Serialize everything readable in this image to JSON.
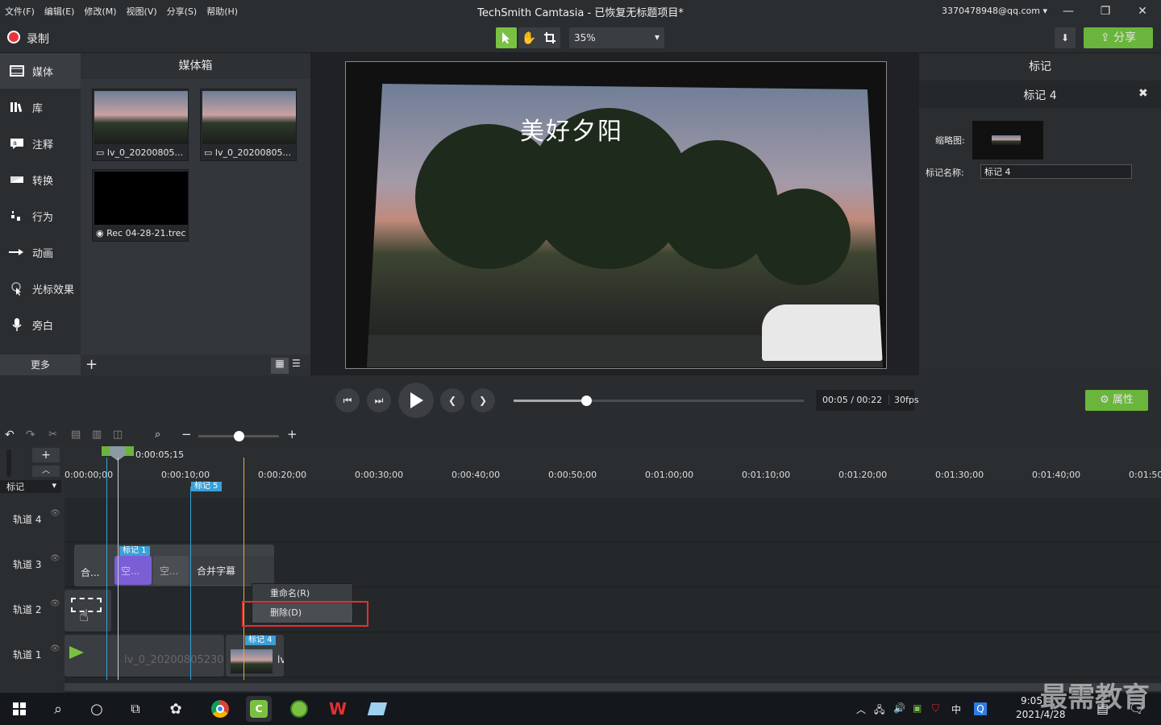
{
  "window": {
    "title": "TechSmith Camtasia - 已恢复无标题项目*",
    "account": "3370478948@qq.com",
    "menu": [
      "文件(F)",
      "编辑(E)",
      "修改(M)",
      "视图(V)",
      "分享(S)",
      "帮助(H)"
    ]
  },
  "toolbar": {
    "record_label": "录制",
    "zoom_value": "35%",
    "share_label": "分享"
  },
  "sidebar": {
    "items": [
      {
        "label": "媒体",
        "icon": "film-icon"
      },
      {
        "label": "库",
        "icon": "library-icon"
      },
      {
        "label": "注释",
        "icon": "annotation-icon"
      },
      {
        "label": "转换",
        "icon": "transition-icon"
      },
      {
        "label": "行为",
        "icon": "behavior-icon"
      },
      {
        "label": "动画",
        "icon": "animation-icon"
      },
      {
        "label": "光标效果",
        "icon": "cursor-icon"
      },
      {
        "label": "旁白",
        "icon": "microphone-icon"
      }
    ],
    "more_label": "更多"
  },
  "media_bin": {
    "title": "媒体箱",
    "items": [
      {
        "name": "lv_0_20200805..."
      },
      {
        "name": "lv_0_20200805..."
      },
      {
        "name": "Rec 04-28-21.trec"
      }
    ]
  },
  "preview": {
    "video_title": "美好夕阳"
  },
  "properties": {
    "header": "标记",
    "subheader": "标记 4",
    "thumb_label": "缩略图:",
    "name_label": "标记名称:",
    "name_value": "标记 4"
  },
  "playback": {
    "progress": 0.25,
    "time": "00:05 / 00:22",
    "fps": "30fps",
    "attr_label": "属性"
  },
  "timeline": {
    "playhead_time": "0:00:05;15",
    "ticks": [
      "0:00:00;00",
      "0:00:10;00",
      "0:00:20;00",
      "0:00:30;00",
      "0:00:40;00",
      "0:00:50;00",
      "0:01:00;00",
      "0:01:10;00",
      "0:01:20;00",
      "0:01:30;00",
      "0:01:40;00",
      "0:01:50;"
    ],
    "marker_label": "标记",
    "tracks": [
      "轨道 4",
      "轨道 3",
      "轨道 2",
      "轨道 1"
    ],
    "markers": [
      "标记 1",
      "标记 5",
      "标记 4"
    ],
    "clips": {
      "t3_a": "合...",
      "t3_b": "空...",
      "t3_c": "空...",
      "t3_d": "合并字幕",
      "t1_a": "lv_0_20200805230",
      "t1_b": "lv"
    }
  },
  "context_menu": {
    "rename": "重命名(R)",
    "delete": "删除(D)"
  },
  "taskbar": {
    "time": "9:05",
    "date": "2021/4/28",
    "ime": "中"
  },
  "watermark": "最需教育"
}
